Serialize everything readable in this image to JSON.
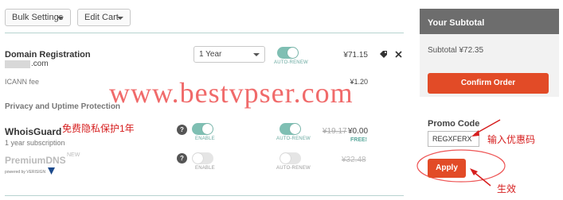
{
  "toolbar": {
    "bulk_settings": "Bulk Settings",
    "edit_cart": "Edit Cart"
  },
  "domain_row": {
    "title": "Domain Registration",
    "domain": ".com",
    "period": "1 Year",
    "auto_renew_label": "AUTO-RENEW",
    "price": "¥71.15",
    "fee_label": "ICANN fee",
    "fee_price": "¥1.20"
  },
  "privacy": {
    "section": "Privacy and Uptime Protection",
    "whoisguard": {
      "title": "WhoisGuard",
      "sub": "1 year subscription",
      "enable_label": "ENABLE",
      "auto_renew_label": "AUTO-RENEW",
      "old_price": "¥19.17",
      "price": "¥0.00",
      "free": "FREE!"
    },
    "premiumdns": {
      "title": "PremiumDNS",
      "new_badge": "NEW",
      "powered": "powered by VERISIGN",
      "enable_label": "ENABLE",
      "auto_renew_label": "AUTO-RENEW",
      "price": "¥32.48"
    }
  },
  "sidebar": {
    "heading": "Your Subtotal",
    "subtotal": "Subtotal ¥72.35",
    "confirm": "Confirm Order",
    "promo_label": "Promo Code",
    "promo_value": "REGXFERX",
    "apply": "Apply"
  },
  "annotations": {
    "watermark": "www.bestvpser.com",
    "free_privacy": "免费隐私保护1年",
    "enter_coupon": "输入优惠码",
    "effect": "生效"
  },
  "colors": {
    "accent": "#e24b27",
    "teal": "#7fbfb3",
    "annot_red": "#d61e1e"
  }
}
